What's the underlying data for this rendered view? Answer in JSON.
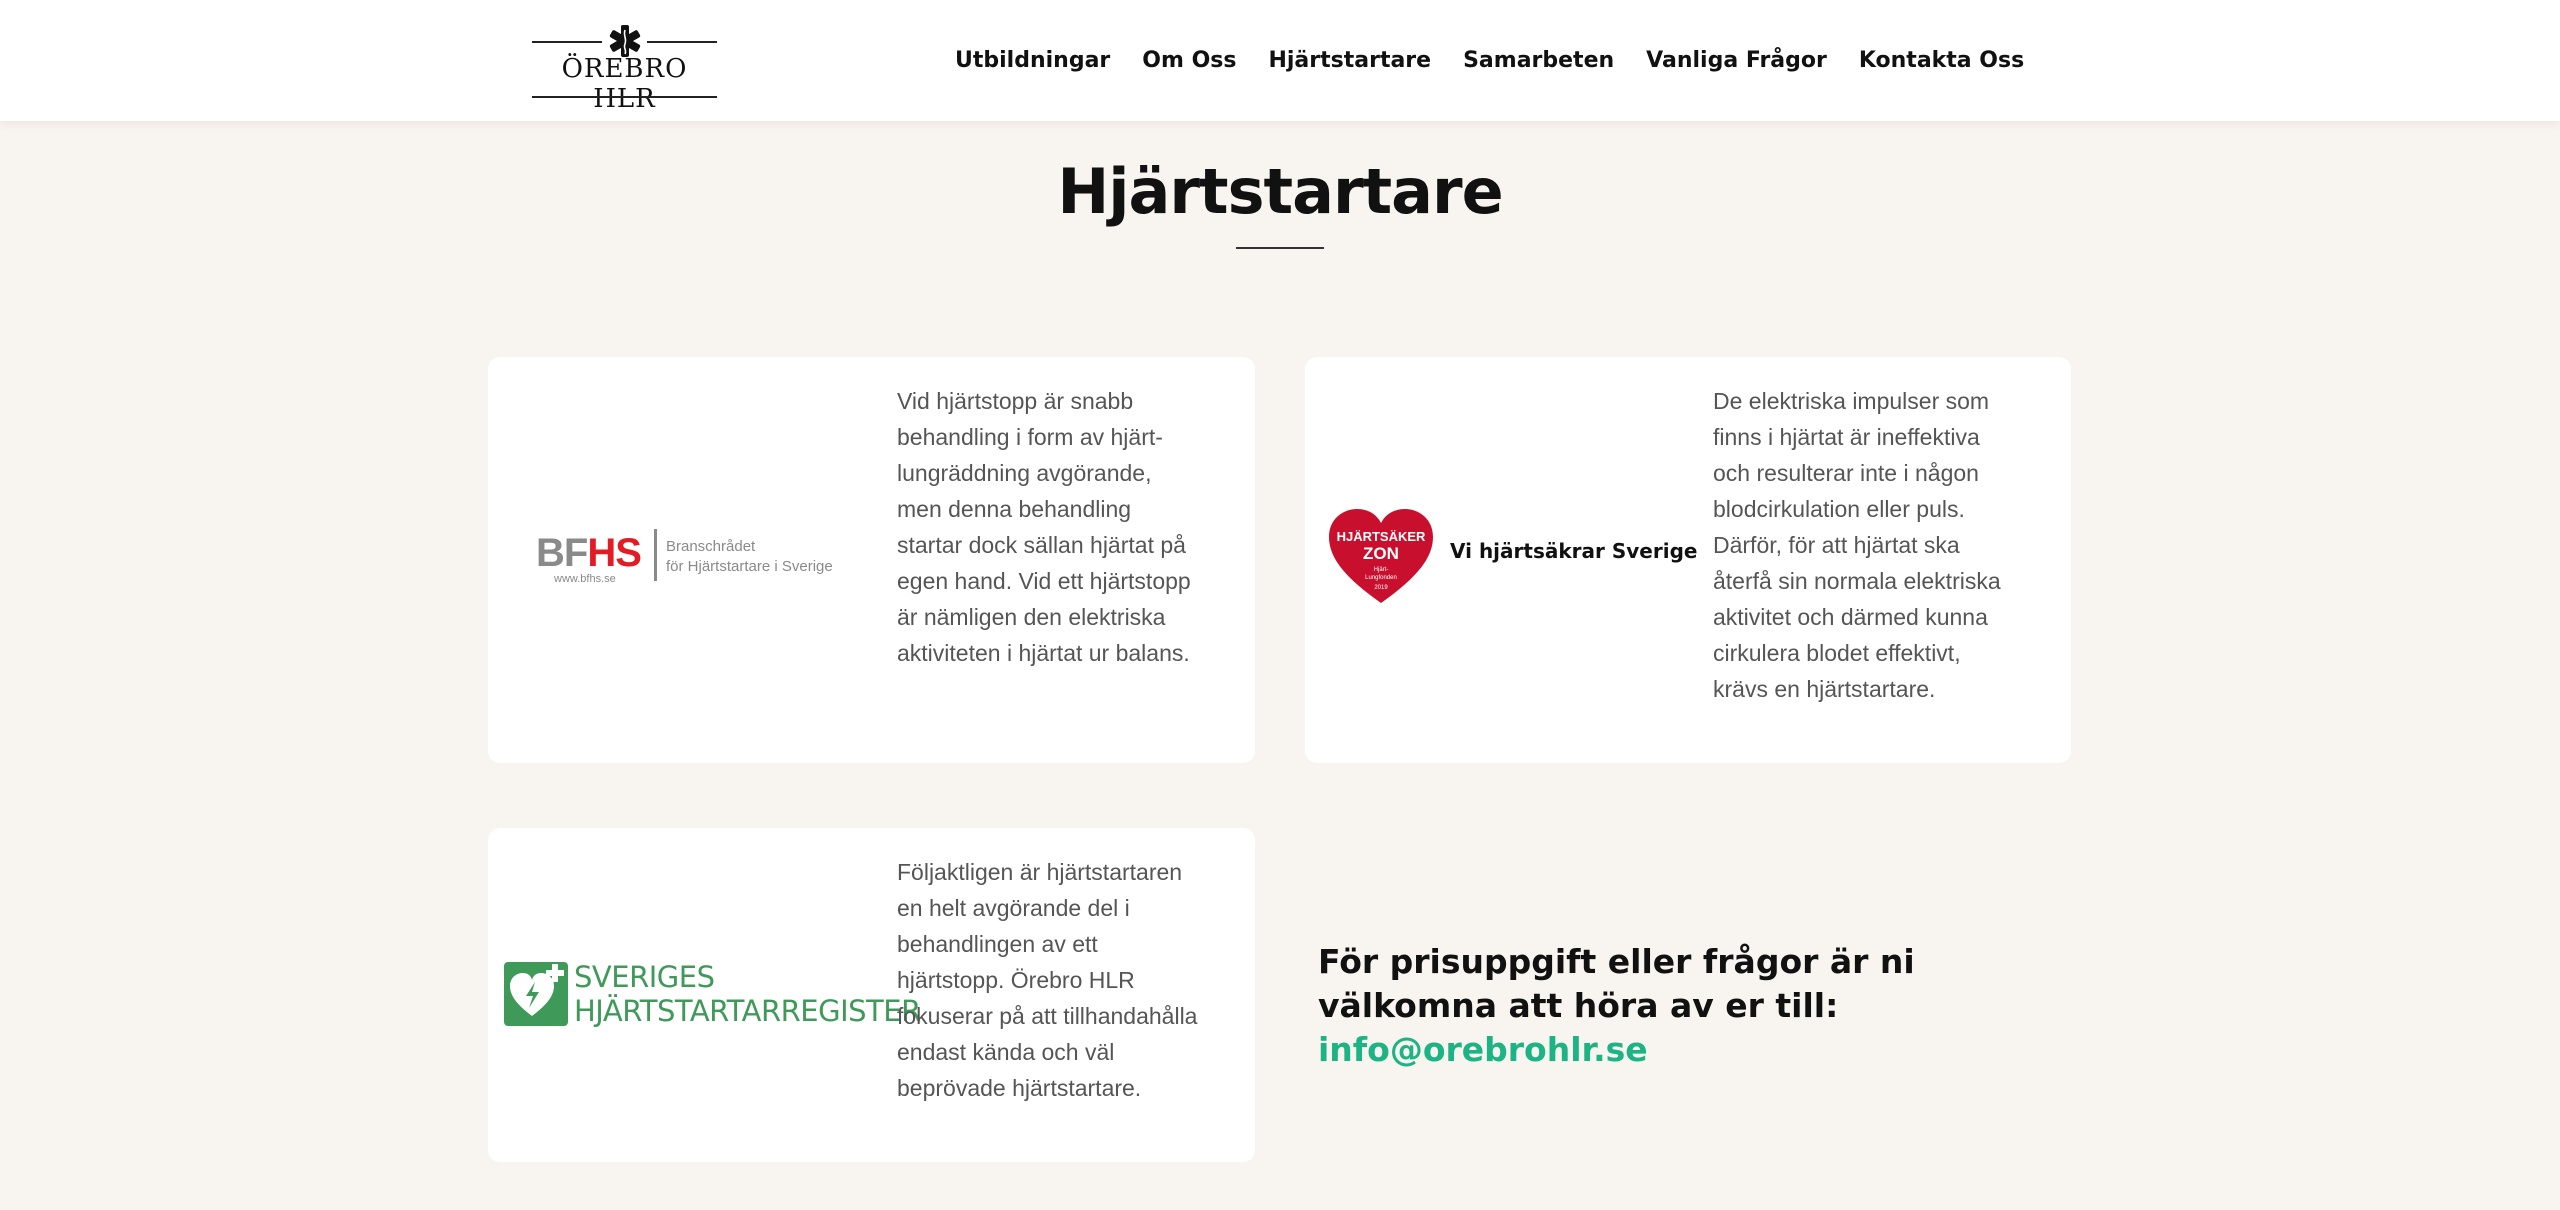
{
  "header": {
    "logo_text": "ÖREBRO HLR",
    "nav": [
      "Utbildningar",
      "Om Oss",
      "Hjärtstartare",
      "Samarbeten",
      "Vanliga Frågor",
      "Kontakta Oss"
    ]
  },
  "page": {
    "title": "Hjärtstartare"
  },
  "cards": [
    {
      "logo": {
        "mark_a": "BF",
        "mark_b": "HS",
        "url": "www.bfhs.se",
        "line1": "Branschrådet",
        "line2": "för Hjärtstartare i Sverige"
      },
      "lines": [
        "Vid hjärtstopp är snabb",
        "behandling i form av hjärt-",
        "lungräddning avgörande,",
        "men denna behandling",
        "startar dock sällan hjärtat på",
        "egen hand. Vid ett hjärtstopp",
        "är nämligen den elektriska",
        "aktiviteten i hjärtat ur balans."
      ]
    },
    {
      "logo": {
        "badge_line1": "HJÄRTSÄKER",
        "badge_line2": "ZON",
        "badge_line3": "Hjärt-",
        "badge_line4": "Lungfonden",
        "badge_year": "2019",
        "claim": "Vi hjärtsäkrar Sverige"
      },
      "lines": [
        "De elektriska impulser som",
        "finns i hjärtat är ineffektiva",
        "och resulterar inte i någon",
        "blodcirkulation eller puls.",
        "Därför, för att hjärtat ska",
        "återfå sin normala elektriska",
        "aktivitet och därmed kunna",
        "cirkulera blodet effektivt,",
        "krävs en hjärtstartare."
      ]
    },
    {
      "logo": {
        "line1": "SVERIGES",
        "line2": "HJÄRTSTARTARREGISTER"
      },
      "lines": [
        "Följaktligen är hjärtstartaren",
        "en helt avgörande del i",
        "behandlingen av ett",
        "hjärtstopp. Örebro HLR",
        "fokuserar på att tillhandahålla",
        "endast kända och väl",
        "beprövade hjärtstartare."
      ]
    }
  ],
  "cta": {
    "text": "För prisuppgift eller frågor är ni välkomna att höra av er till:",
    "email": "info@orebrohlr.se"
  },
  "colors": {
    "page_bg": "#f8f4f0",
    "accent_green": "#1cb385",
    "bfhs_red": "#e21c24",
    "shr_green": "#3f9a5a",
    "heart_red": "#c8102e"
  }
}
